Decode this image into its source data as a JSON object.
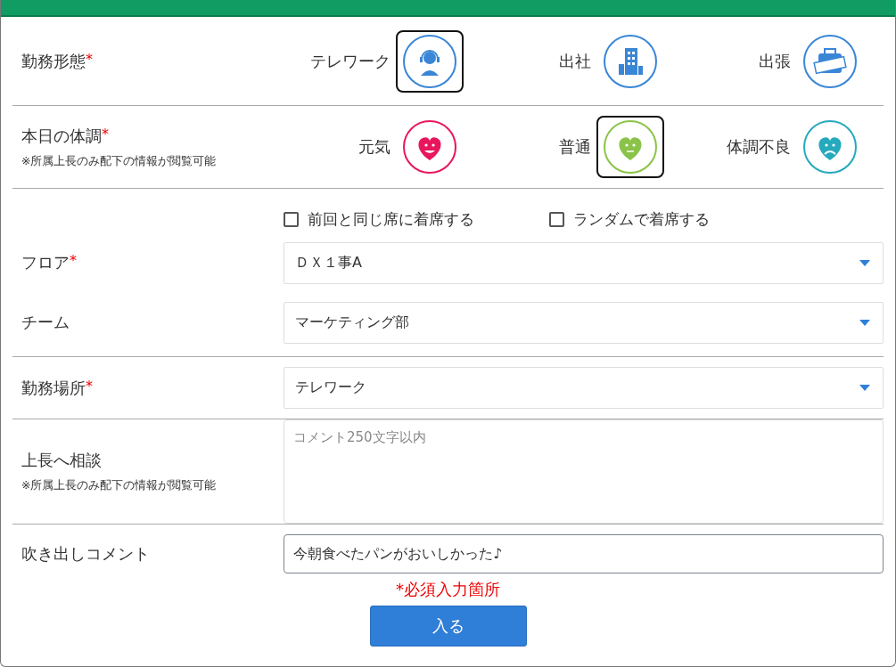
{
  "work_style": {
    "label": "勤務形態",
    "mark": "*",
    "options": [
      {
        "label": "テレワーク",
        "kind": "headset",
        "selected": true
      },
      {
        "label": "出社",
        "kind": "building",
        "selected": false
      },
      {
        "label": "出張",
        "kind": "ticket",
        "selected": false
      }
    ]
  },
  "condition": {
    "label": "本日の体調",
    "mark": "*",
    "note": "※所属上長のみ配下の情報が閲覧可能",
    "options": [
      {
        "label": "元気",
        "kind": "happy",
        "color": "#e8175d",
        "selected": false
      },
      {
        "label": "普通",
        "kind": "neutral",
        "color": "#8bc34a",
        "selected": true
      },
      {
        "label": "体調不良",
        "kind": "sad",
        "color": "#26a9bd",
        "selected": false
      }
    ]
  },
  "seat_options": [
    {
      "label": "前回と同じ席に着席する",
      "checked": false
    },
    {
      "label": "ランダムで着席する",
      "checked": false
    }
  ],
  "floor": {
    "label": "フロア",
    "mark": "*",
    "value": "ＤＸ１事A"
  },
  "team": {
    "label": "チーム",
    "value": "マーケティング部"
  },
  "location": {
    "label": "勤務場所",
    "mark": "*",
    "value": "テレワーク"
  },
  "consult": {
    "label": "上長へ相談",
    "note": "※所属上長のみ配下の情報が閲覧可能",
    "placeholder": "コメント250文字以内"
  },
  "bubble_comment": {
    "label": "吹き出しコメント",
    "value": "今朝食べたパンがおいしかった♪"
  },
  "required_note": "*必須入力箇所",
  "submit_button": "入る"
}
